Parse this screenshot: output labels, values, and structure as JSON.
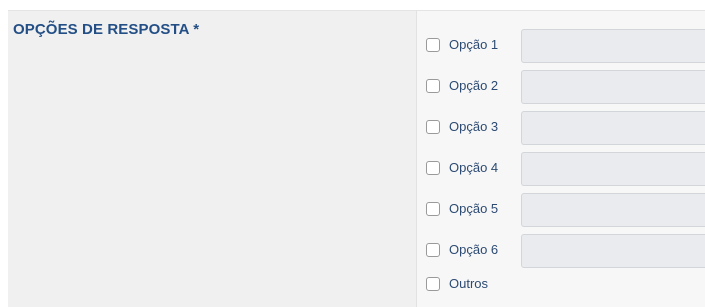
{
  "section": {
    "title": "OPÇÕES DE RESPOSTA *"
  },
  "options": [
    {
      "label": "Opção 1",
      "value": ""
    },
    {
      "label": "Opção 2",
      "value": ""
    },
    {
      "label": "Opção 3",
      "value": ""
    },
    {
      "label": "Opção 4",
      "value": ""
    },
    {
      "label": "Opção 5",
      "value": ""
    },
    {
      "label": "Opção 6",
      "value": ""
    },
    {
      "label": "Outros"
    }
  ],
  "colors": {
    "title": "#234f86",
    "label_bg": "#f0f0f0",
    "input_bg": "#e9ebee"
  }
}
